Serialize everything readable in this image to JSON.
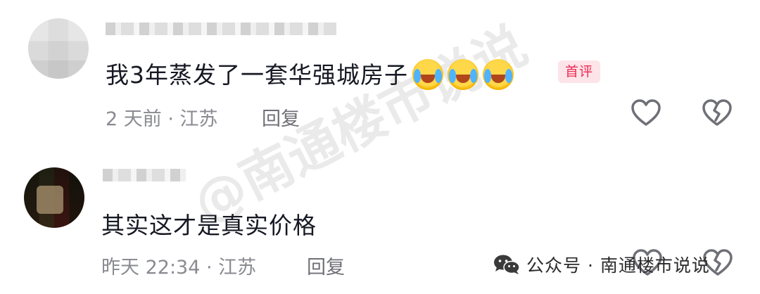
{
  "comments": [
    {
      "text": "我3年蒸发了一套华强城房子",
      "emoji_count": 3,
      "emoji_icon": "crying-laughing-face-icon",
      "badge": "首评",
      "meta": "2 天前 · 江苏",
      "reply_label": "回复"
    },
    {
      "text": "其实这才是真实价格",
      "meta": "昨天 22:34 · 江苏",
      "reply_label": "回复"
    }
  ],
  "watermark": {
    "diagonal": "@南通楼市说说",
    "footer": "公众号 · 南通楼市说说",
    "footer_icon": "wechat-icon"
  },
  "icons": {
    "like": "heart-outline-icon",
    "dislike": "broken-heart-icon"
  },
  "colors": {
    "text": "#161823",
    "meta": "#8a8b91",
    "badge_bg": "#fde4e8",
    "badge_text": "#ee2a55"
  }
}
